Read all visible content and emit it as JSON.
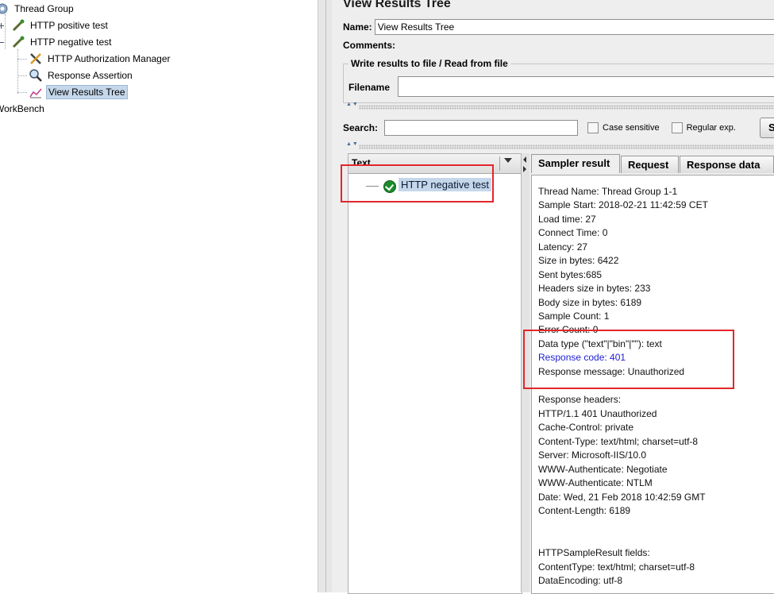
{
  "tree": {
    "nodes": [
      {
        "label": "Thread Group"
      },
      {
        "label": "HTTP positive test"
      },
      {
        "label": "HTTP negative test"
      },
      {
        "label": "HTTP Authorization Manager"
      },
      {
        "label": "Response Assertion"
      },
      {
        "label": "View Results Tree"
      },
      {
        "label": "WorkBench"
      }
    ]
  },
  "panel": {
    "title": "View Results Tree",
    "name_label": "Name:",
    "name_value": "View Results Tree",
    "comments_label": "Comments:",
    "file_group_legend": "Write results to file / Read from file",
    "filename_label": "Filename",
    "search_label": "Search:",
    "case_sensitive_label": "Case sensitive",
    "regular_exp_label": "Regular exp.",
    "search_button_label": "S"
  },
  "results": {
    "column_header": "Text",
    "sample_label": "HTTP negative test",
    "sample_status": "success"
  },
  "tabs": [
    {
      "label": "Sampler result",
      "active": true
    },
    {
      "label": "Request",
      "active": false
    },
    {
      "label": "Response data",
      "active": false
    }
  ],
  "sampler_result": {
    "lines": [
      "Thread Name: Thread Group 1-1",
      "Sample Start: 2018-02-21 11:42:59 CET",
      "Load time: 27",
      "Connect Time: 0",
      "Latency: 27",
      "Size in bytes: 6422",
      "Sent bytes:685",
      "Headers size in bytes: 233",
      "Body size in bytes: 6189",
      "Sample Count: 1",
      "Error Count: 0",
      "Data type (\"text\"|\"bin\"|\"\"): text",
      "Response code: 401",
      "Response message: Unauthorized",
      "",
      "Response headers:",
      "HTTP/1.1 401 Unauthorized",
      "Cache-Control: private",
      "Content-Type: text/html; charset=utf-8",
      "Server: Microsoft-IIS/10.0",
      "WWW-Authenticate: Negotiate",
      "WWW-Authenticate: NTLM",
      "Date: Wed, 21 Feb 2018 10:42:59 GMT",
      "Content-Length: 6189",
      "",
      "",
      "HTTPSampleResult fields:",
      "ContentType: text/html; charset=utf-8",
      "DataEncoding: utf-8"
    ]
  },
  "colors": {
    "highlight": "#e3262b",
    "selection": "#c5d7ea",
    "response_code": "#1d1dd8"
  }
}
